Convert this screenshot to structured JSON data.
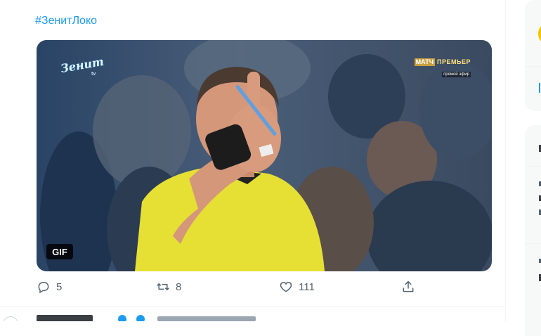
{
  "tweet": {
    "hashtag": "#ЗенитЛоко",
    "media": {
      "type": "gif",
      "badge": "GIF",
      "overlay_logo": "Зенит",
      "overlay_logo_sub": "tv",
      "broadcast_box": "МАТЧ",
      "broadcast_name": "ПРЕМЬЕР",
      "broadcast_live": "прямой эфир"
    },
    "actions": {
      "reply_count": "5",
      "retweet_count": "8",
      "like_count": "111"
    }
  },
  "colors": {
    "accent": "#1d9bf0",
    "text_secondary": "#536471",
    "referee_shirt": "#e6e034"
  },
  "icons": [
    "reply-icon",
    "retweet-icon",
    "like-icon",
    "share-icon"
  ]
}
